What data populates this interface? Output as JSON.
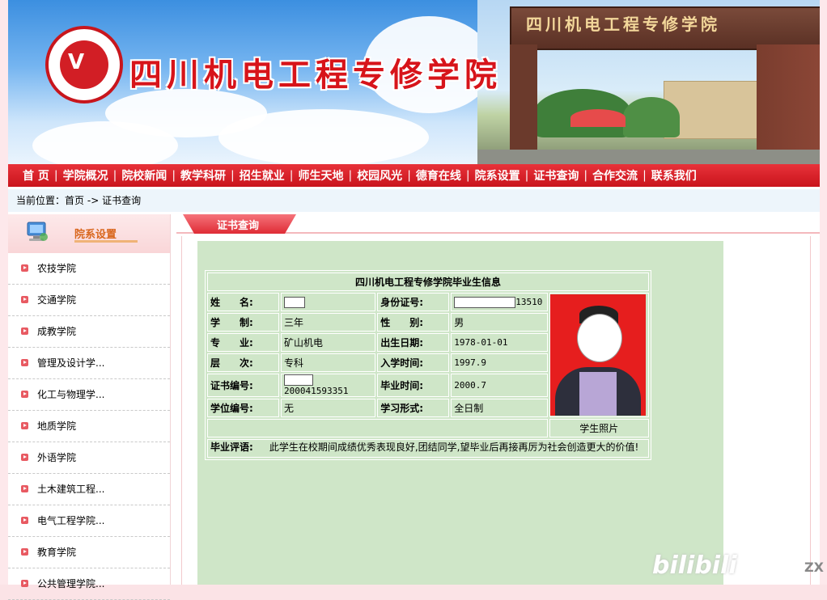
{
  "header": {
    "school_name": "四川机电工程专修学院",
    "gate_sign": "四川机电工程专修学院"
  },
  "nav": {
    "items": [
      "首 页",
      "学院概况",
      "院校新闻",
      "教学科研",
      "招生就业",
      "师生天地",
      "校园风光",
      "德育在线",
      "院系设置",
      "证书查询",
      "合作交流",
      "联系我们"
    ]
  },
  "breadcrumb": {
    "prefix": "当前位置：",
    "home": "首页",
    "arrow": "->",
    "current": "证书查询"
  },
  "sidebar": {
    "title": "院系设置",
    "items": [
      "农技学院",
      "交通学院",
      "成教学院",
      "管理及设计学...",
      "化工与物理学...",
      "地质学院",
      "外语学院",
      "土木建筑工程...",
      "电气工程学院...",
      "教育学院",
      "公共管理学院..."
    ]
  },
  "content": {
    "tab_label": "证书查询",
    "table_title": "四川机电工程专修学院毕业生信息",
    "fields": {
      "name_label": "姓　　名:",
      "name_value": "",
      "id_label": "身份证号:",
      "id_value_suffix": "13510",
      "study_label": "学　　制:",
      "study_value": "三年",
      "gender_label": "性　　别:",
      "gender_value": "男",
      "major_label": "专　　业:",
      "major_value": "矿山机电",
      "birth_label": "出生日期:",
      "birth_value": "1978-01-01",
      "level_label": "层　　次:",
      "level_value": "专科",
      "enroll_label": "入学时间:",
      "enroll_value": "1997.9",
      "cert_label": "证书编号:",
      "cert_value_suffix": "200041593351",
      "grad_label": "毕业时间:",
      "grad_value": "2000.7",
      "degree_label": "学位编号:",
      "degree_value": "无",
      "mode_label": "学习形式:",
      "mode_value": "全日制",
      "photo_caption": "学生照片",
      "comment_label": "毕业评语:",
      "comment_value": "此学生在校期间成绩优秀表现良好,团结同学,望毕业后再接再厉为社会创造更大的价值!"
    }
  },
  "watermark": {
    "text": "bilibili",
    "suffix": "ZX"
  },
  "colors": {
    "brand_red": "#d7141a",
    "nav_red": "#c9141c",
    "content_green": "#cfe6c8",
    "sidebar_title": "#d9661c"
  }
}
